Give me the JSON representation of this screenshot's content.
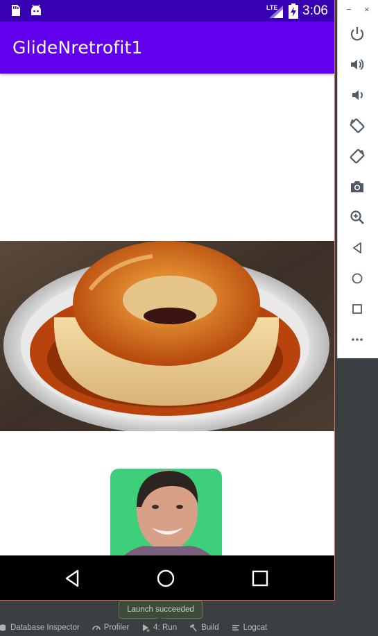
{
  "status_bar": {
    "time": "3:06",
    "network": "LTE",
    "icons": [
      "sd-card-icon",
      "android-icon",
      "lte-signal-icon",
      "battery-charging-icon"
    ]
  },
  "app_bar": {
    "title": "GlideNretrofit1"
  },
  "content": {
    "images": [
      {
        "name": "flan-image",
        "subject": "caramel flan on a white plate"
      },
      {
        "name": "profile-photo",
        "subject": "smiling man on green background"
      }
    ]
  },
  "nav_bar": {
    "buttons": [
      "back-icon",
      "home-icon",
      "recents-icon"
    ]
  },
  "emulator_toolbar": {
    "window_buttons": [
      "−",
      "×"
    ],
    "tools": [
      "power-icon",
      "volume-up-icon",
      "volume-down-icon",
      "rotate-left-icon",
      "rotate-right-icon",
      "screenshot-icon",
      "zoom-icon",
      "back-icon",
      "home-icon",
      "overview-icon",
      "more-icon"
    ]
  },
  "toast": {
    "text": "Launch succeeded"
  },
  "ide_bar": {
    "tabs": [
      {
        "label": "Database Inspector",
        "icon": "database-icon"
      },
      {
        "label": "Profiler",
        "icon": "profiler-gauge-icon"
      },
      {
        "label": "4: Run",
        "icon": "run-icon"
      },
      {
        "label": "Build",
        "icon": "hammer-icon"
      },
      {
        "label": "Logcat",
        "icon": "logcat-icon"
      }
    ]
  },
  "colors": {
    "status_bar": "#3700b3",
    "app_bar": "#6200ee",
    "nav_bar": "#000000",
    "avatar_bg": "#3ecf7a",
    "caramel": "#c4540e",
    "custard": "#e8c98a"
  }
}
